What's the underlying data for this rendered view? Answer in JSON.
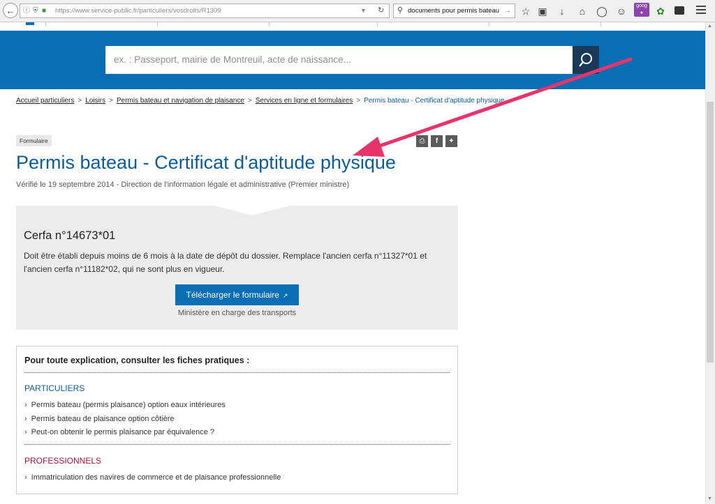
{
  "browser": {
    "url_prefix": "https://www.service-public.fr",
    "url_path": "/particuliers/vosdroits/R1309",
    "search_query": "documents pour permis bateau",
    "goog_badge": "goog"
  },
  "header": {
    "search_placeholder": "ex. : Passeport, mairie de Montreuil, acte de naissance..."
  },
  "breadcrumb": [
    "Accueil particuliers",
    "Loisirs",
    "Permis bateau et navigation de plaisance",
    "Services en ligne et formulaires",
    "Permis bateau - Certificat d'aptitude physique"
  ],
  "breadcrumb_separator": ">",
  "page": {
    "badge": "Formulaire",
    "title": "Permis bateau - Certificat d'aptitude physique",
    "verified": "Vérifié le 19 septembre 2014 - Direction de l'information légale et administrative (Premier ministre)"
  },
  "form": {
    "cerfa": "Cerfa n°14673*01",
    "description": "Doit être établi depuis moins de 6 mois à la date de dépôt du dossier. Remplace l'ancien cerfa n°11327*01 et l'ancien cerfa n°11182*02, qui ne sont plus en vigueur.",
    "download_label": "Télécharger le formulaire",
    "ministry": "Ministère en charge des transports"
  },
  "info": {
    "heading": "Pour toute explication, consulter les fiches pratiques :",
    "particuliers_label": "PARTICULIERS",
    "particuliers_links": [
      "Permis bateau (permis plaisance) option eaux intérieures",
      "Permis bateau de plaisance option côtière",
      "Peut-on obtenir le permis plaisance par équivalence ?"
    ],
    "professionnels_label": "PROFESSIONNELS",
    "professionnels_links": [
      "Immatriculation des navires de commerce et de plaisance professionnelle"
    ]
  },
  "colors": {
    "brand_blue": "#0a6eb4",
    "title_blue": "#0a5c9a",
    "search_button": "#1b3a59",
    "professionnels_red": "#a2133a",
    "annotation_arrow": "#e8336b"
  }
}
